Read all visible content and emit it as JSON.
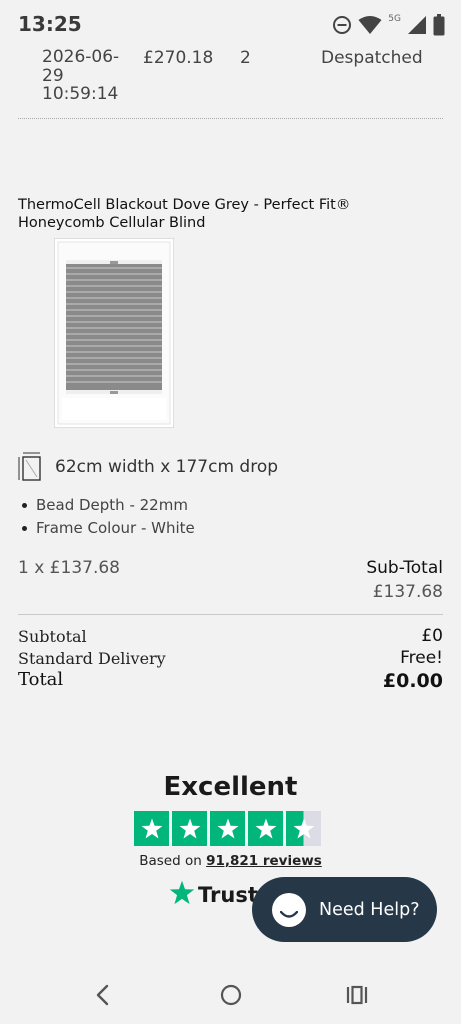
{
  "status_bar": {
    "time": "13:25",
    "network_label": "5G",
    "icons": [
      "do-not-disturb-icon",
      "wifi-icon",
      "signal-icon",
      "battery-icon"
    ]
  },
  "order": {
    "date": "2026-06-29 10:59:14",
    "price": "£270.18",
    "quantity": "2",
    "status": "Despatched"
  },
  "product": {
    "title": "ThermoCell Blackout Dove Grey - Perfect Fit® Honeycomb Cellular Blind",
    "size": "62cm width x 177cm drop",
    "options": [
      "Bead Depth - 22mm",
      "Frame Colour - White"
    ],
    "qty_price": "1 x £137.68",
    "subtotal_label": "Sub-Total",
    "subtotal_value": "£137.68"
  },
  "totals": {
    "subtotal_label": "Subtotal",
    "subtotal_value": "£0",
    "delivery_label": "Standard Delivery",
    "delivery_value": "Free!",
    "total_label": "Total",
    "total_value": "£0.00"
  },
  "trustpilot": {
    "heading": "Excellent",
    "rating_stars": 4.5,
    "based_on": "Based on",
    "reviews_link": "91,821 reviews",
    "logo_text": "Trustpilot",
    "brand_color": "#00b67a"
  },
  "help_button": {
    "label": "Need Help?",
    "color": "#263747"
  },
  "nav": {
    "icons": [
      "back-icon",
      "home-icon",
      "recent-apps-icon"
    ]
  }
}
